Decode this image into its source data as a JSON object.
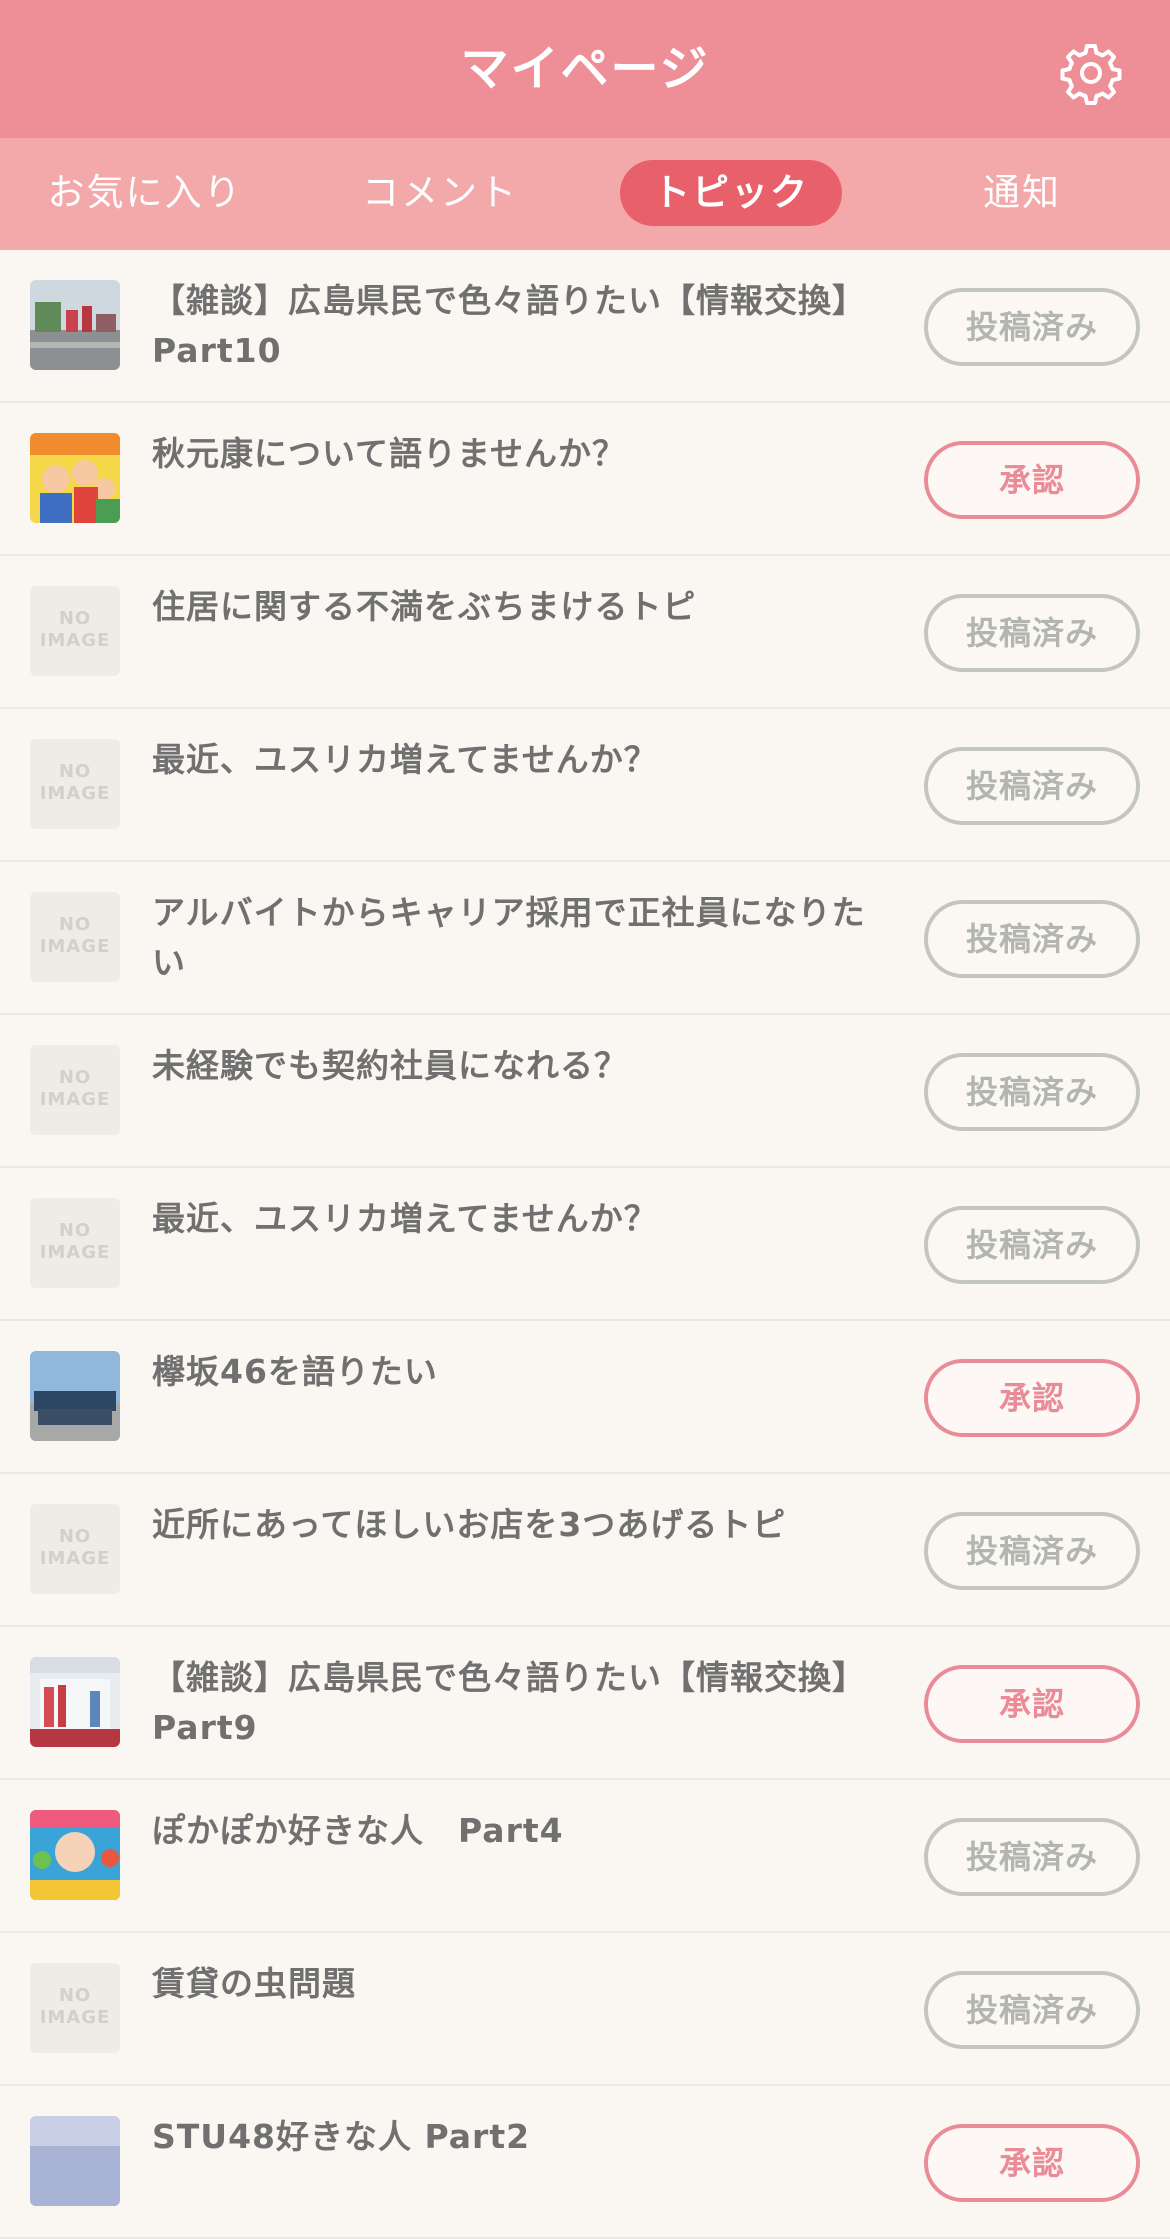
{
  "header": {
    "title": "マイページ"
  },
  "colors": {
    "header": "#ee8e96",
    "tabs": "#f3a8aa",
    "active_tab": "#e8606a",
    "approved": "#ea8c98",
    "posted": "#c3c6bf"
  },
  "tabs": [
    {
      "label": "お気に入り",
      "active": false
    },
    {
      "label": "コメント",
      "active": false
    },
    {
      "label": "トピック",
      "active": true
    },
    {
      "label": "通知",
      "active": false
    }
  ],
  "no_image": {
    "line1": "NO",
    "line2": "IMAGE"
  },
  "topics": [
    {
      "title": "【雑談】広島県民で色々語りたい【情報交換】Part10",
      "status": "投稿済み",
      "approved": false,
      "thumb": "street-photo"
    },
    {
      "title": "秋元康について語りませんか？",
      "status": "承認",
      "approved": true,
      "thumb": "cartoon-photo"
    },
    {
      "title": "住居に関する不満をぶちまけるトピ",
      "status": "投稿済み",
      "approved": false,
      "thumb": "none"
    },
    {
      "title": "最近、ユスリカ増えてませんか？",
      "status": "投稿済み",
      "approved": false,
      "thumb": "none"
    },
    {
      "title": "アルバイトからキャリア採用で正社員になりたい",
      "status": "投稿済み",
      "approved": false,
      "thumb": "none"
    },
    {
      "title": "未経験でも契約社員になれる？",
      "status": "投稿済み",
      "approved": false,
      "thumb": "none"
    },
    {
      "title": "最近、ユスリカ増えてませんか？",
      "status": "投稿済み",
      "approved": false,
      "thumb": "none"
    },
    {
      "title": "欅坂46を語りたい",
      "status": "承認",
      "approved": true,
      "thumb": "group-photo"
    },
    {
      "title": "近所にあってほしいお店を3つあげるトピ",
      "status": "投稿済み",
      "approved": false,
      "thumb": "none"
    },
    {
      "title": "【雑談】広島県民で色々語りたい【情報交換】Part9",
      "status": "承認",
      "approved": true,
      "thumb": "event-photo"
    },
    {
      "title": "ぽかぽか好きな人　Part4",
      "status": "投稿済み",
      "approved": false,
      "thumb": "colorful-photo"
    },
    {
      "title": "賃貸の虫問題",
      "status": "投稿済み",
      "approved": false,
      "thumb": "none"
    },
    {
      "title": "STU48好きな人 Part2",
      "status": "承認",
      "approved": true,
      "thumb": "group-photo-2"
    }
  ]
}
